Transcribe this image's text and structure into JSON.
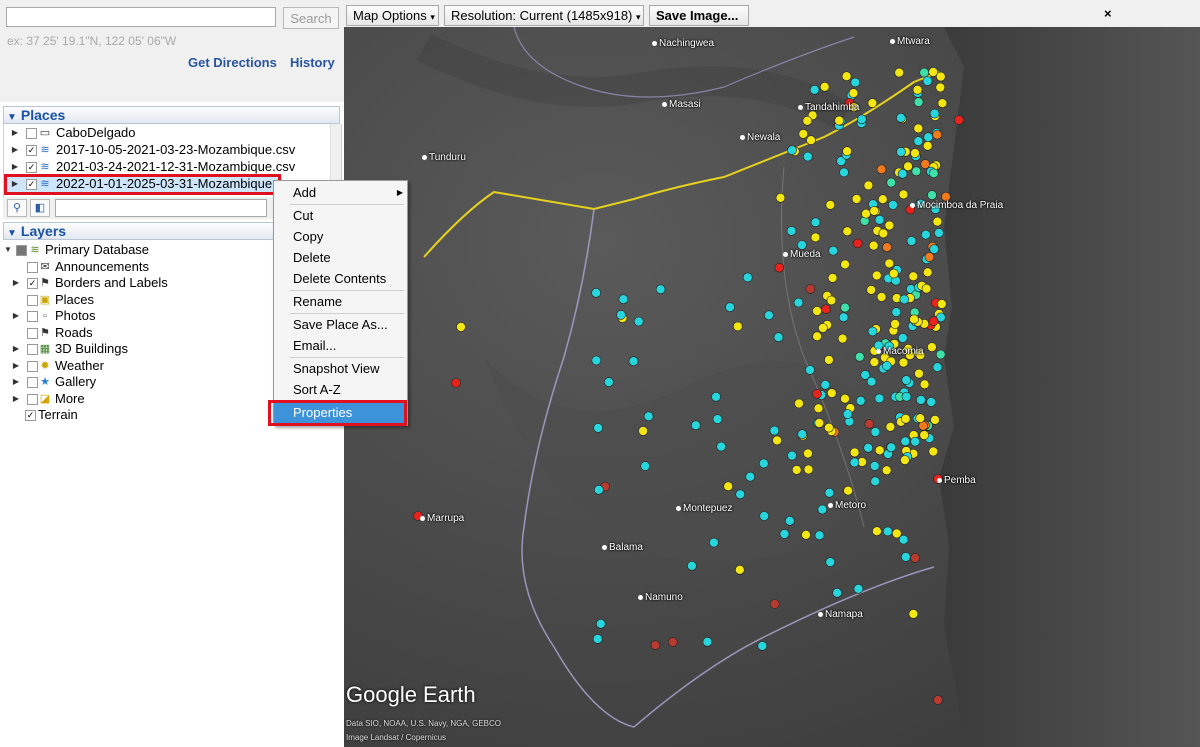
{
  "search": {
    "placeholder": "",
    "button": "Search",
    "hint": "ex: 37 25' 19.1\"N, 122 05' 06\"W"
  },
  "links": {
    "directions": "Get Directions",
    "history": "History"
  },
  "places": {
    "title": "Places",
    "items": [
      {
        "label": "CaboDelgado",
        "checked": false
      },
      {
        "label": "2017-10-05-2021-03-23-Mozambique.csv",
        "checked": true
      },
      {
        "label": "2021-03-24-2021-12-31-Mozambique.csv",
        "checked": true
      },
      {
        "label": "2022-01-01-2025-03-31-Mozambique.c",
        "checked": true
      }
    ]
  },
  "layers": {
    "title": "Layers",
    "root": "Primary Database",
    "items": [
      {
        "label": "Announcements",
        "checked": false
      },
      {
        "label": "Borders and Labels",
        "checked": true
      },
      {
        "label": "Places",
        "checked": false
      },
      {
        "label": "Photos",
        "checked": false
      },
      {
        "label": "Roads",
        "checked": false
      },
      {
        "label": "3D Buildings",
        "checked": false
      },
      {
        "label": "Weather",
        "checked": false
      },
      {
        "label": "Gallery",
        "checked": false
      },
      {
        "label": "More",
        "checked": false
      },
      {
        "label": "Terrain",
        "checked": true
      }
    ]
  },
  "toolbar": {
    "map_options": "Map Options",
    "resolution": "Resolution: Current (1485x918)",
    "save": "Save Image...",
    "close": "×"
  },
  "context_menu": {
    "add": "Add",
    "cut": "Cut",
    "copy": "Copy",
    "delete": "Delete",
    "delete_contents": "Delete Contents",
    "rename": "Rename",
    "save_as": "Save Place As...",
    "email": "Email...",
    "snapshot": "Snapshot View",
    "sort": "Sort A-Z",
    "properties": "Properties"
  },
  "map": {
    "cities": {
      "nachingwea": "Nachingwea",
      "mtwara": "Mtwara",
      "masasi": "Masasi",
      "tandahimba": "Tandahimba",
      "newala": "Newala",
      "tunduru": "Tunduru",
      "mocimboa": "Mocimboa da Praia",
      "mueda": "Mueda",
      "macomia": "Macomia",
      "pemba": "Pemba",
      "marrupa": "Marrupa",
      "montepuez": "Montepuez",
      "metoro": "Metoro",
      "balama": "Balama",
      "namuno": "Namuno",
      "namapa": "Namapa"
    },
    "brand": "Google Earth",
    "credit1": "Data SIO, NOAA, U.S. Navy, NGA, GEBCO",
    "credit2": "Image Landsat / Copernicus",
    "marker_colors": {
      "yellow": "#f4e610",
      "cyan": "#27d6dc",
      "red": "#e8231c",
      "orange": "#f07a1c",
      "dark_red": "#b83a30",
      "mint": "#3fe0a8"
    }
  }
}
